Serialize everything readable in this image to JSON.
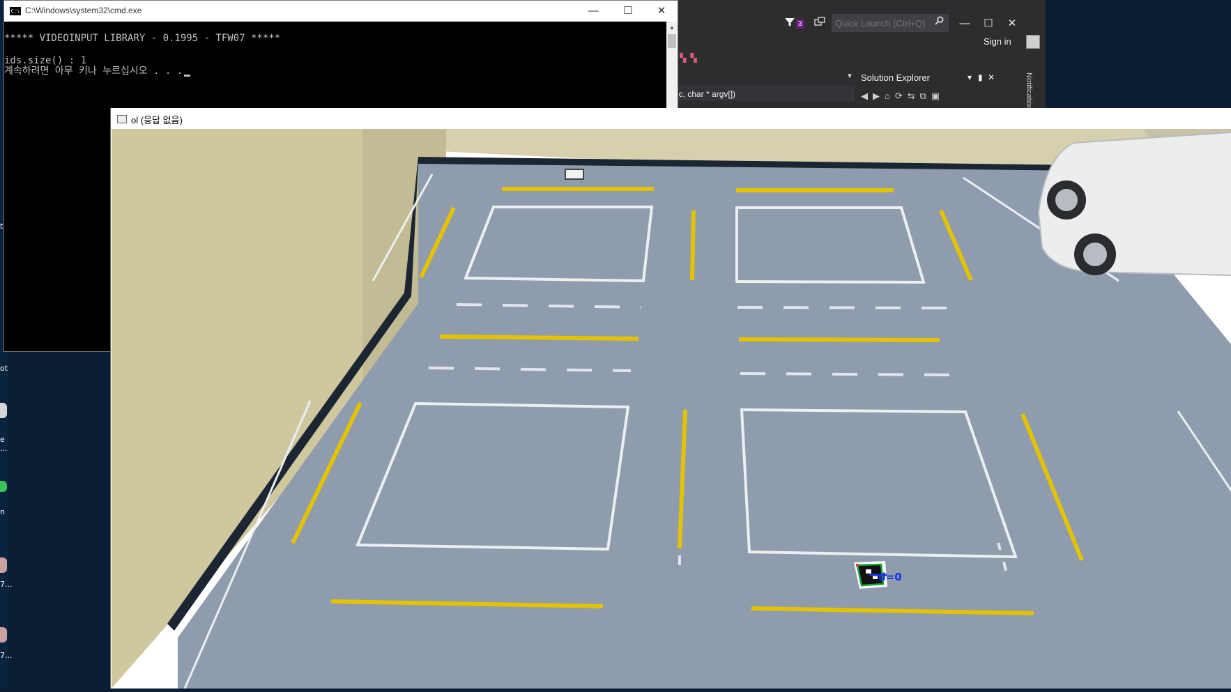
{
  "desktop": {
    "icon_labels": [
      "t",
      "ot",
      "e\n...",
      "n",
      "7...",
      "7..."
    ]
  },
  "cmd_window": {
    "title": "C:\\Windows\\system32\\cmd.exe",
    "icon_text": "C:\\",
    "minimize": "—",
    "maximize": "☐",
    "close": "✕",
    "lines": [
      "***** VIDEOINPUT LIBRARY - 0.1995 - TFW07 *****",
      "",
      "ids.size() : 1",
      "계속하려면 아무 키나 누르십시오 . . ."
    ]
  },
  "visual_studio": {
    "filter_badge": "3",
    "quick_launch_placeholder": "Quick Launch (Ctrl+Q)",
    "sign_in": "Sign in",
    "function_combo": "gc, char * argv[])",
    "solution_explorer_title": "Solution Explorer",
    "notifications_tab": "Notifications",
    "minimize": "—",
    "maximize": "☐",
    "close": "✕"
  },
  "camera_window": {
    "title": "ol (응답 없음)",
    "marker_id_label": "d=0"
  },
  "colors": {
    "floor": "#8f9cad",
    "wall": "#ddd7b7",
    "lane_yellow": "#e3c200",
    "line_white": "#eceff1",
    "marker_axis_blue": "#1432e6",
    "marker_box_green": "#11a03a",
    "vs_background": "#2d2d30"
  }
}
